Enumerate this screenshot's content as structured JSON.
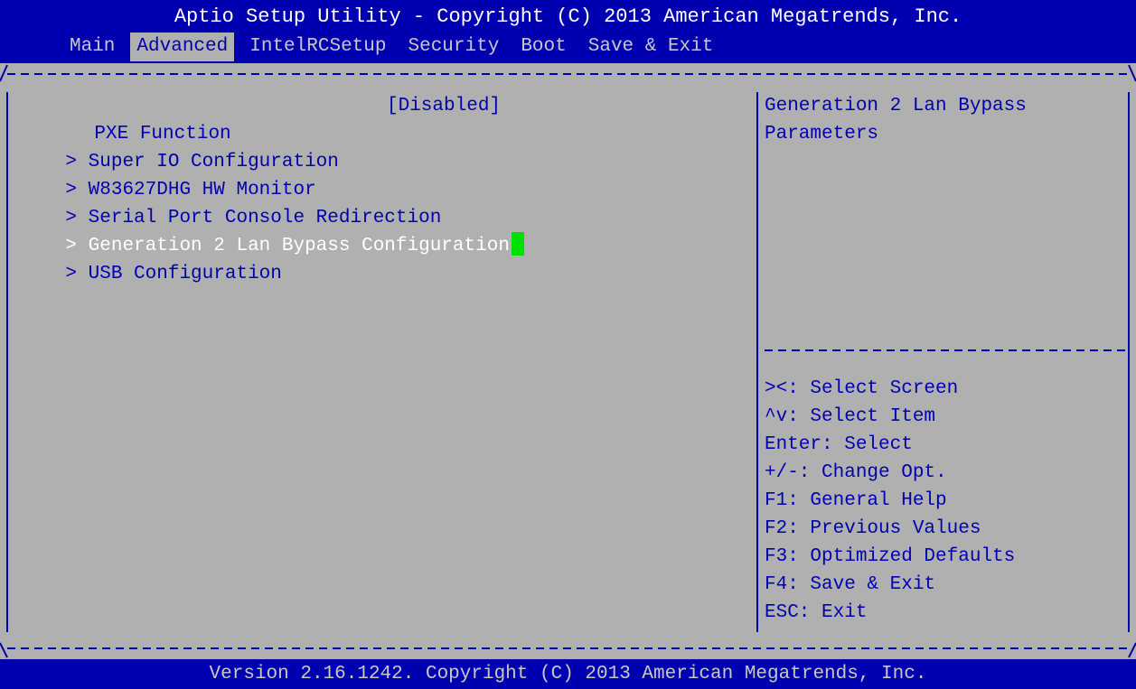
{
  "header": {
    "title": "Aptio Setup Utility - Copyright (C) 2013 American Megatrends, Inc.",
    "tabs": [
      "Main",
      "Advanced",
      "IntelRCSetup",
      "Security",
      "Boot",
      "Save & Exit"
    ],
    "active_tab": "Advanced"
  },
  "menu": {
    "pxe_label": "PXE Function",
    "pxe_value": "[Disabled]",
    "submenus": [
      "Super IO Configuration",
      "W83627DHG HW Monitor",
      "Serial Port Console Redirection",
      "Generation 2 Lan Bypass Configuration",
      "USB Configuration"
    ],
    "submenu_marker": "> ",
    "selected": "Generation 2 Lan Bypass Configuration"
  },
  "help": {
    "lines": [
      "Generation 2 Lan Bypass",
      "Parameters"
    ]
  },
  "keys": [
    "><: Select Screen",
    "^v: Select Item",
    "Enter: Select",
    "+/-: Change Opt.",
    "F1: General Help",
    "F2: Previous Values",
    "F3: Optimized Defaults",
    "F4: Save & Exit",
    "ESC: Exit"
  ],
  "footer": {
    "version": "Version 2.16.1242. Copyright (C) 2013 American Megatrends, Inc."
  },
  "colors": {
    "header_bg": "#0000b0",
    "body_bg": "#b0b0b0",
    "text": "#0000b0",
    "selected_text": "#ffffff",
    "cursor": "#00e000"
  }
}
